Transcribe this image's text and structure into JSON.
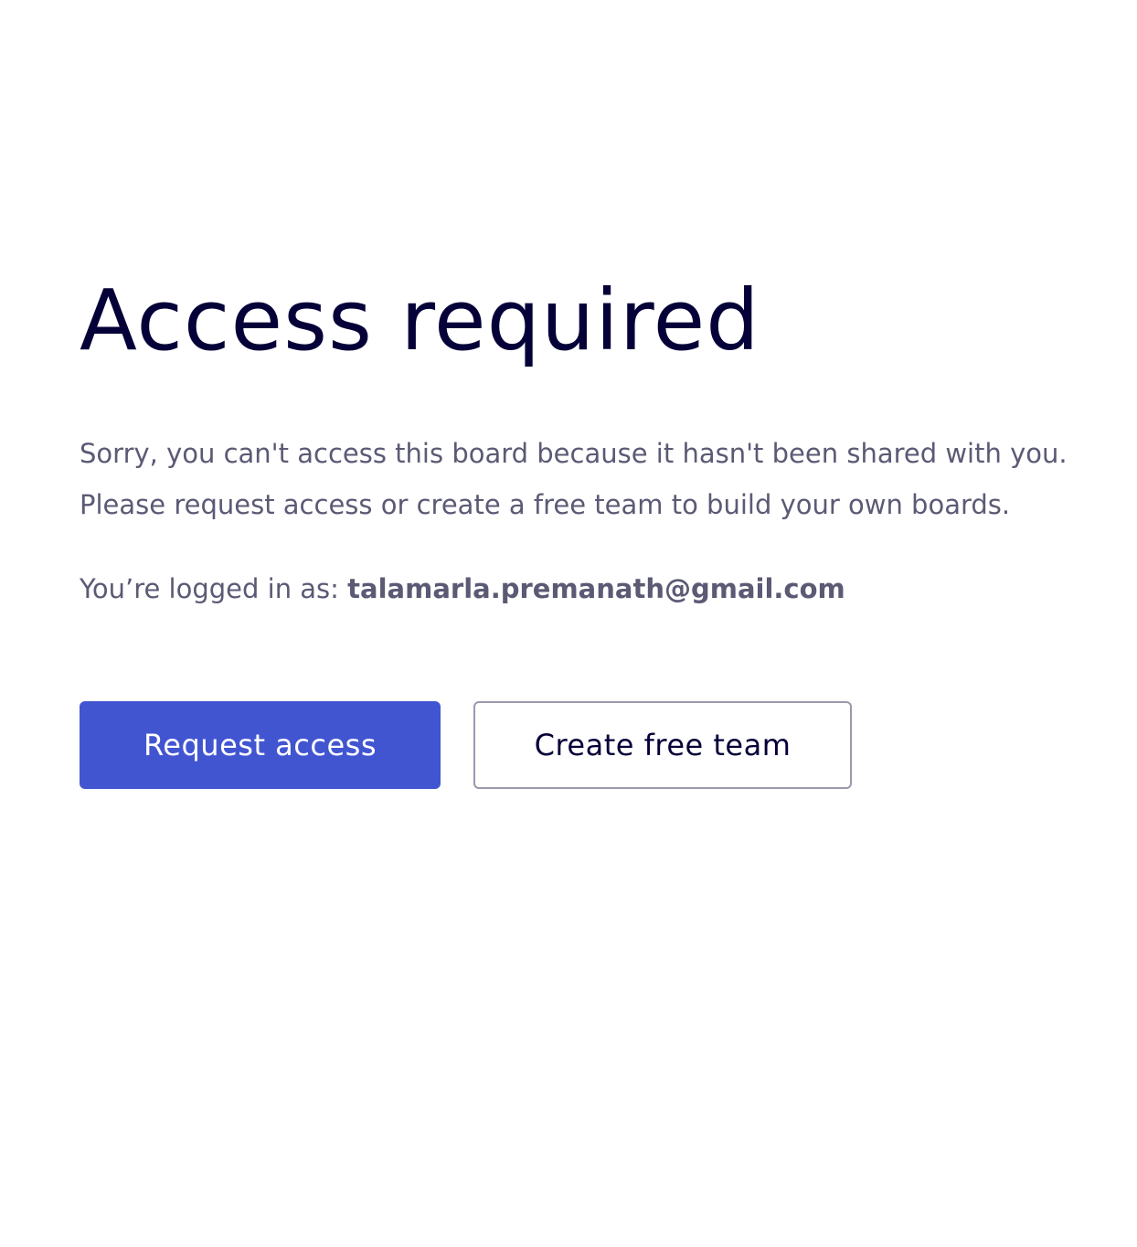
{
  "page": {
    "title": "Access required",
    "message_line1": "Sorry, you can't access this board because it hasn't been shared with you.",
    "message_line2": "Please request access or create a free team to build your own boards.",
    "logged_in_label": "You’re logged in as: ",
    "logged_in_email": "talamarla.premanath@gmail.com"
  },
  "actions": {
    "request_access_label": "Request access",
    "create_team_label": "Create free team"
  },
  "colors": {
    "title": "#050038",
    "body_text": "#5b5a75",
    "primary_button": "#4255d1",
    "secondary_border": "#9a99ad"
  }
}
